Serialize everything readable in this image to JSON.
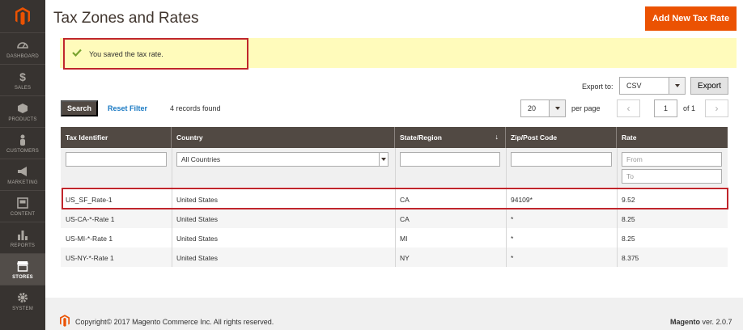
{
  "sidebar": {
    "items": [
      {
        "label": "DASHBOARD",
        "icon": "dashboard-icon"
      },
      {
        "label": "SALES",
        "icon": "dollar-icon"
      },
      {
        "label": "PRODUCTS",
        "icon": "box-icon"
      },
      {
        "label": "CUSTOMERS",
        "icon": "person-icon"
      },
      {
        "label": "MARKETING",
        "icon": "megaphone-icon"
      },
      {
        "label": "CONTENT",
        "icon": "content-icon"
      },
      {
        "label": "REPORTS",
        "icon": "bar-chart-icon"
      },
      {
        "label": "STORES",
        "icon": "store-icon"
      },
      {
        "label": "SYSTEM",
        "icon": "gear-icon"
      }
    ]
  },
  "header": {
    "title": "Tax Zones and Rates",
    "add_button": "Add New Tax Rate"
  },
  "message": {
    "text": "You saved the tax rate."
  },
  "export": {
    "label": "Export to:",
    "format": "CSV",
    "button": "Export"
  },
  "toolbar": {
    "search": "Search",
    "reset": "Reset Filter",
    "records": "4 records found",
    "per_page_value": "20",
    "per_page_label": "per page",
    "page": "1",
    "of_total": "of 1"
  },
  "grid": {
    "columns": [
      "Tax Identifier",
      "Country",
      "State/Region",
      "Zip/Post Code",
      "Rate"
    ],
    "sort_indicator": "↓",
    "filters": {
      "country": "All Countries",
      "rate_from": "From",
      "rate_to": "To"
    },
    "rows": [
      [
        "US_SF_Rate-1",
        "United States",
        "CA",
        "94109*",
        "9.52"
      ],
      [
        "US-CA-*-Rate 1",
        "United States",
        "CA",
        "*",
        "8.25"
      ],
      [
        "US-MI-*-Rate 1",
        "United States",
        "MI",
        "*",
        "8.25"
      ],
      [
        "US-NY-*-Rate 1",
        "United States",
        "NY",
        "*",
        "8.375"
      ]
    ]
  },
  "footer": {
    "copyright": "Copyright© 2017 Magento Commerce Inc. All rights reserved.",
    "brand": "Magento",
    "version": "ver. 2.0.7"
  },
  "colors": {
    "sidebar": "#373330",
    "accent": "#eb5202",
    "header_row": "#514943",
    "highlight": "#c0262c",
    "message_bg": "#fffbbb"
  }
}
